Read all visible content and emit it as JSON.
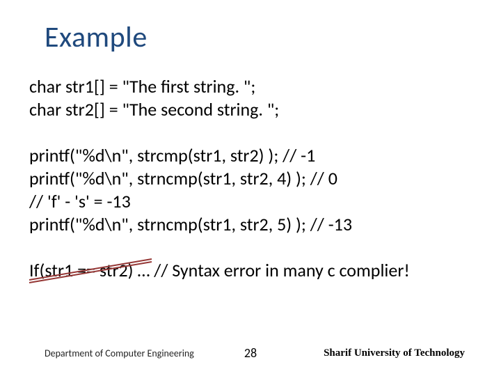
{
  "title": "Example",
  "code": {
    "line1": "char str1[] = \"The first string. \";",
    "line2": "char str2[] = \"The second string. \";",
    "line3": "printf(\"%d\\n\", strcmp(str1, str2) ); // -1",
    "line4": "printf(\"%d\\n\", strncmp(str1, str2, 4) ); // 0",
    "line5": "// 'f' - 's' = -13",
    "line6": "printf(\"%d\\n\", strncmp(str1, str2, 5) ); // -13",
    "if_part": "If(str1 == str2)",
    "if_rest": " … // Syntax error in many c complier!"
  },
  "footer": {
    "dept": "Department of Computer Engineering",
    "page": "28",
    "uni": "Sharif University of Technology"
  }
}
